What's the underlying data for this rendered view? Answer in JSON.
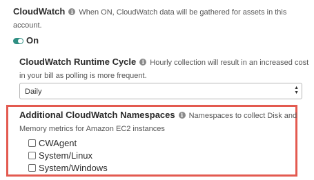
{
  "cloudwatch": {
    "title": "CloudWatch",
    "description_line1": "When ON, CloudWatch data will be gathered for assets in this",
    "description_line2": "account.",
    "toggle_label": "On"
  },
  "runtime_cycle": {
    "title": "CloudWatch Runtime Cycle",
    "description_line1": "Hourly collection will result in an increased cost",
    "description_line2": "in your bill as polling is more frequent.",
    "selected_value": "Daily"
  },
  "namespaces": {
    "title": "Additional CloudWatch Namespaces",
    "description_line1": "Namespaces to collect Disk and",
    "description_line2": "Memory metrics for Amazon EC2 instances",
    "options": [
      "CWAgent",
      "System/Linux",
      "System/Windows"
    ]
  },
  "colors": {
    "accent_toggle": "#2f8f83",
    "highlight_border": "#e35a50"
  },
  "icons": {
    "info": "info-icon",
    "toggle": "toggle-switch-icon",
    "select_arrows": "up-down-arrows-icon"
  }
}
